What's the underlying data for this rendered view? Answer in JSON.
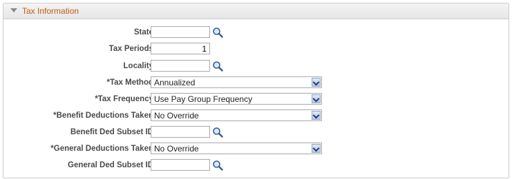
{
  "section": {
    "title": "Tax Information"
  },
  "fields": {
    "state": {
      "label": "State",
      "value": ""
    },
    "tax_periods": {
      "label": "Tax Periods",
      "value": "1"
    },
    "locality": {
      "label": "Locality",
      "value": ""
    },
    "tax_method": {
      "label": "Tax Method",
      "required": "*",
      "value": "Annualized"
    },
    "tax_frequency": {
      "label": "Tax Frequency",
      "required": "*",
      "value": "Use Pay Group Frequency"
    },
    "benefit_deductions_taken": {
      "label": "Benefit Deductions Taken",
      "required": "*",
      "value": "No Override"
    },
    "benefit_ded_subset_id": {
      "label": "Benefit Ded Subset ID",
      "value": ""
    },
    "general_deductions_taken": {
      "label": "General Deductions Taken",
      "required": "*",
      "value": "No Override"
    },
    "general_ded_subset_id": {
      "label": "General Ded Subset ID",
      "value": ""
    }
  },
  "icons": {
    "lookup": "magnifier-lookup-icon",
    "dropdown": "chevron-down-icon",
    "collapse": "triangle-down-icon"
  },
  "colors": {
    "title": "#c05a16",
    "header_bg": "#ececec",
    "border": "#cdcdcd"
  }
}
